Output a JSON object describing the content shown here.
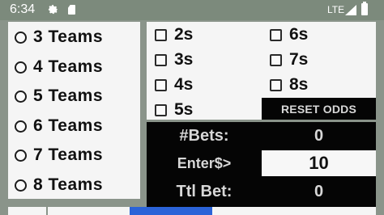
{
  "status_bar": {
    "time": "6:34",
    "network": "LTE"
  },
  "teams": {
    "options": [
      "3 Teams",
      "4 Teams",
      "5 Teams",
      "6 Teams",
      "7 Teams",
      "8 Teams"
    ]
  },
  "bets": {
    "left_options": [
      "2s",
      "3s",
      "4s",
      "5s"
    ],
    "right_options": [
      "6s",
      "7s",
      "8s"
    ],
    "reset_label": "RESET ODDS"
  },
  "summary": {
    "bets_label": "#Bets:",
    "bets_value": "0",
    "enter_label": "Enter$>",
    "enter_value": "10",
    "total_label": "Ttl Bet:",
    "total_value": "0"
  }
}
